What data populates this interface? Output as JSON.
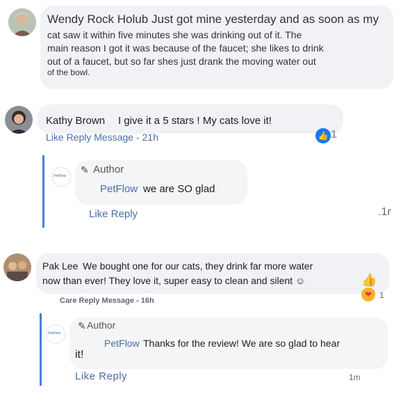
{
  "comments": [
    {
      "author": "Wendy Rock Holub",
      "line1": "Just got mine yesterday and as soon as my",
      "line2": "cat saw it within five minutes she was drinking out of it. The",
      "line3": "main reason I got it was because of the faucet; she likes to drink",
      "line4": "out of a faucet, but so far shes just drank the moving water out",
      "line5": "of the bowl."
    },
    {
      "author": "Kathy Brown",
      "text": "I give it a 5 stars ! My cats love it!",
      "actions": "Like Reply Message - 21h",
      "reaction_count": "1"
    },
    {
      "author": "Pak Lee",
      "line1": "We bought one for our cats, they drink far more water",
      "line2": "now than ever! They love it, super easy to clean and silent ☺",
      "actions": "Care Reply Message - 16h",
      "reaction_count": "1"
    }
  ],
  "replies": [
    {
      "badge": "Author",
      "author": "PetFlow",
      "text": "we are SO glad",
      "actions": "Like Reply",
      "time": ".1r",
      "avatar_text": "PetFlow"
    },
    {
      "badge": "Author",
      "author": "PetFlow",
      "line1": "Thanks for the review! We are so glad to hear",
      "line2": "it!",
      "actions": "Like Reply",
      "time": "1m",
      "avatar_text": "PetFlow"
    }
  ]
}
